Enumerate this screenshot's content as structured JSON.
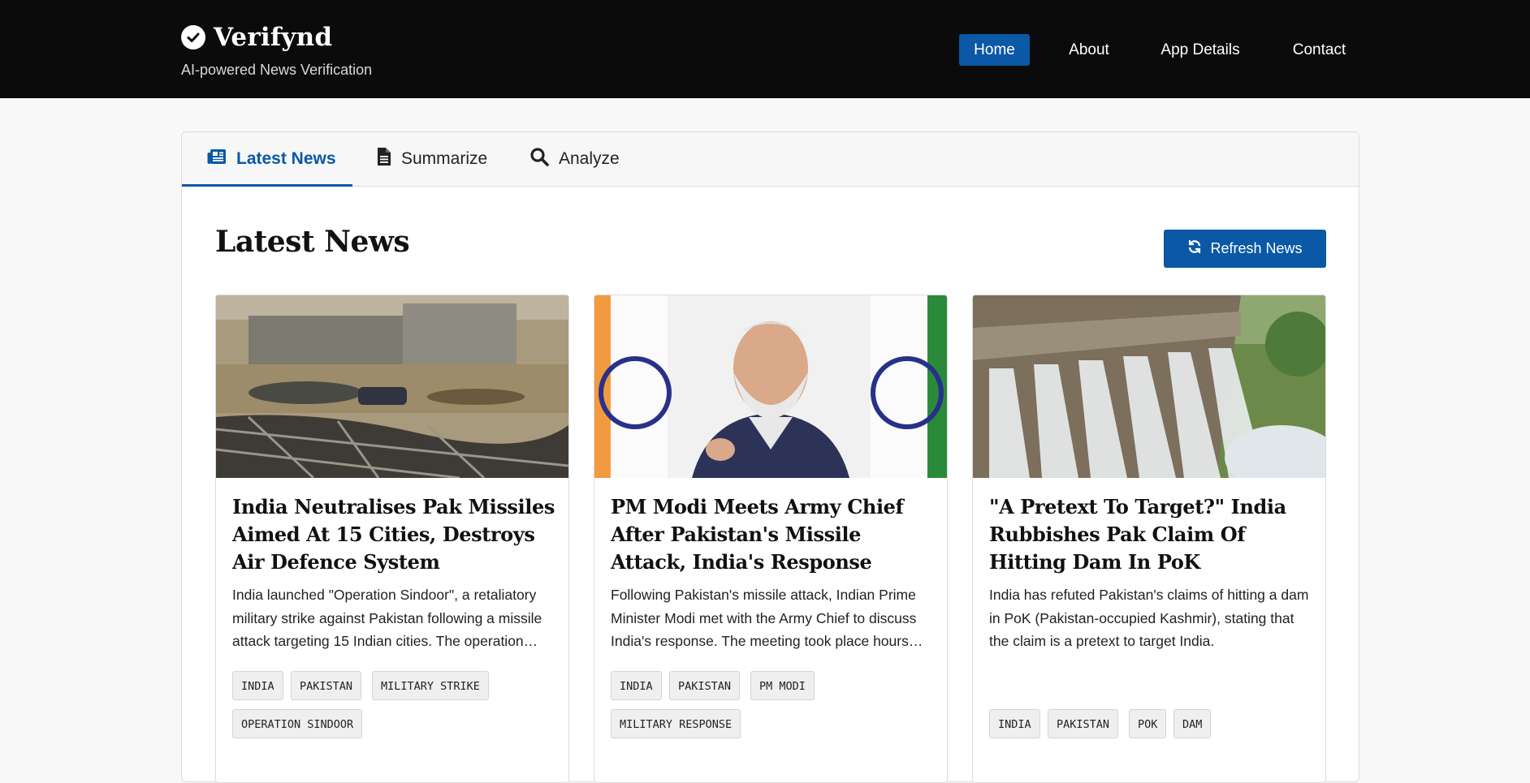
{
  "header": {
    "brand_name": "Verifynd",
    "tagline": "AI-powered News Verification",
    "nav": [
      {
        "label": "Home",
        "active": true
      },
      {
        "label": "About",
        "active": false
      },
      {
        "label": "App Details",
        "active": false
      },
      {
        "label": "Contact",
        "active": false
      }
    ]
  },
  "tabs": [
    {
      "label": "Latest News",
      "icon": "newspaper-icon",
      "active": true
    },
    {
      "label": "Summarize",
      "icon": "document-icon",
      "active": false
    },
    {
      "label": "Analyze",
      "icon": "search-icon",
      "active": false
    }
  ],
  "main": {
    "title": "Latest News",
    "refresh_label": "Refresh News"
  },
  "articles": [
    {
      "title": "India Neutralises Pak Missiles Aimed At 15 Cities, Destroys Air Defence System",
      "summary": "India launched \"Operation Sindoor\", a retaliatory military strike against Pakistan following a missile attack targeting 15 Indian cities. The operation…",
      "tags": [
        "INDIA",
        "PAKISTAN",
        "MILITARY STRIKE",
        "OPERATION SINDOOR"
      ]
    },
    {
      "title": "PM Modi Meets Army Chief After Pakistan's Missile Attack, India's Response",
      "summary": "Following Pakistan's missile attack, Indian Prime Minister Modi met with the Army Chief to discuss India's response. The meeting took place hours…",
      "tags": [
        "INDIA",
        "PAKISTAN",
        "PM MODI",
        "MILITARY RESPONSE"
      ]
    },
    {
      "title": "\"A Pretext To Target?\" India Rubbishes Pak Claim Of Hitting Dam In PoK",
      "summary": "India has refuted Pakistan's claims of hitting a dam in PoK (Pakistan-occupied Kashmir), stating that the claim is a pretext to target India.",
      "tags": [
        "INDIA",
        "PAKISTAN",
        "POK",
        "DAM"
      ]
    }
  ],
  "colors": {
    "header_bg": "#0b0b0b",
    "accent": "#0a58a6",
    "tag_bg": "#efefef"
  }
}
